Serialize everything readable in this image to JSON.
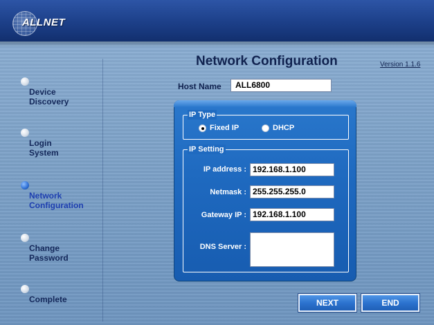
{
  "header": {
    "brand": "ALLNET"
  },
  "title": "Network Configuration",
  "version": "Version 1.1.6",
  "sidebar": {
    "items": [
      {
        "label": "Device\nDiscovery",
        "active": false
      },
      {
        "label": "Login\nSystem",
        "active": false
      },
      {
        "label": "Network\nConfiguration",
        "active": true
      },
      {
        "label": "Change\nPassword",
        "active": false
      },
      {
        "label": "Complete",
        "active": false
      }
    ]
  },
  "host": {
    "label": "Host Name",
    "value": "ALL6800"
  },
  "ip_type": {
    "legend": "IP Type",
    "options": [
      {
        "label": "Fixed IP",
        "checked": true
      },
      {
        "label": "DHCP",
        "checked": false
      }
    ]
  },
  "ip_setting": {
    "legend": "IP Setting",
    "fields": [
      {
        "label": "IP address :",
        "value": "192.168.1.100"
      },
      {
        "label": "Netmask :",
        "value": "255.255.255.0"
      },
      {
        "label": "Gateway IP :",
        "value": "192.168.1.100"
      },
      {
        "label": "DNS Server :",
        "value": ""
      }
    ]
  },
  "buttons": {
    "next": "NEXT",
    "end": "END"
  }
}
